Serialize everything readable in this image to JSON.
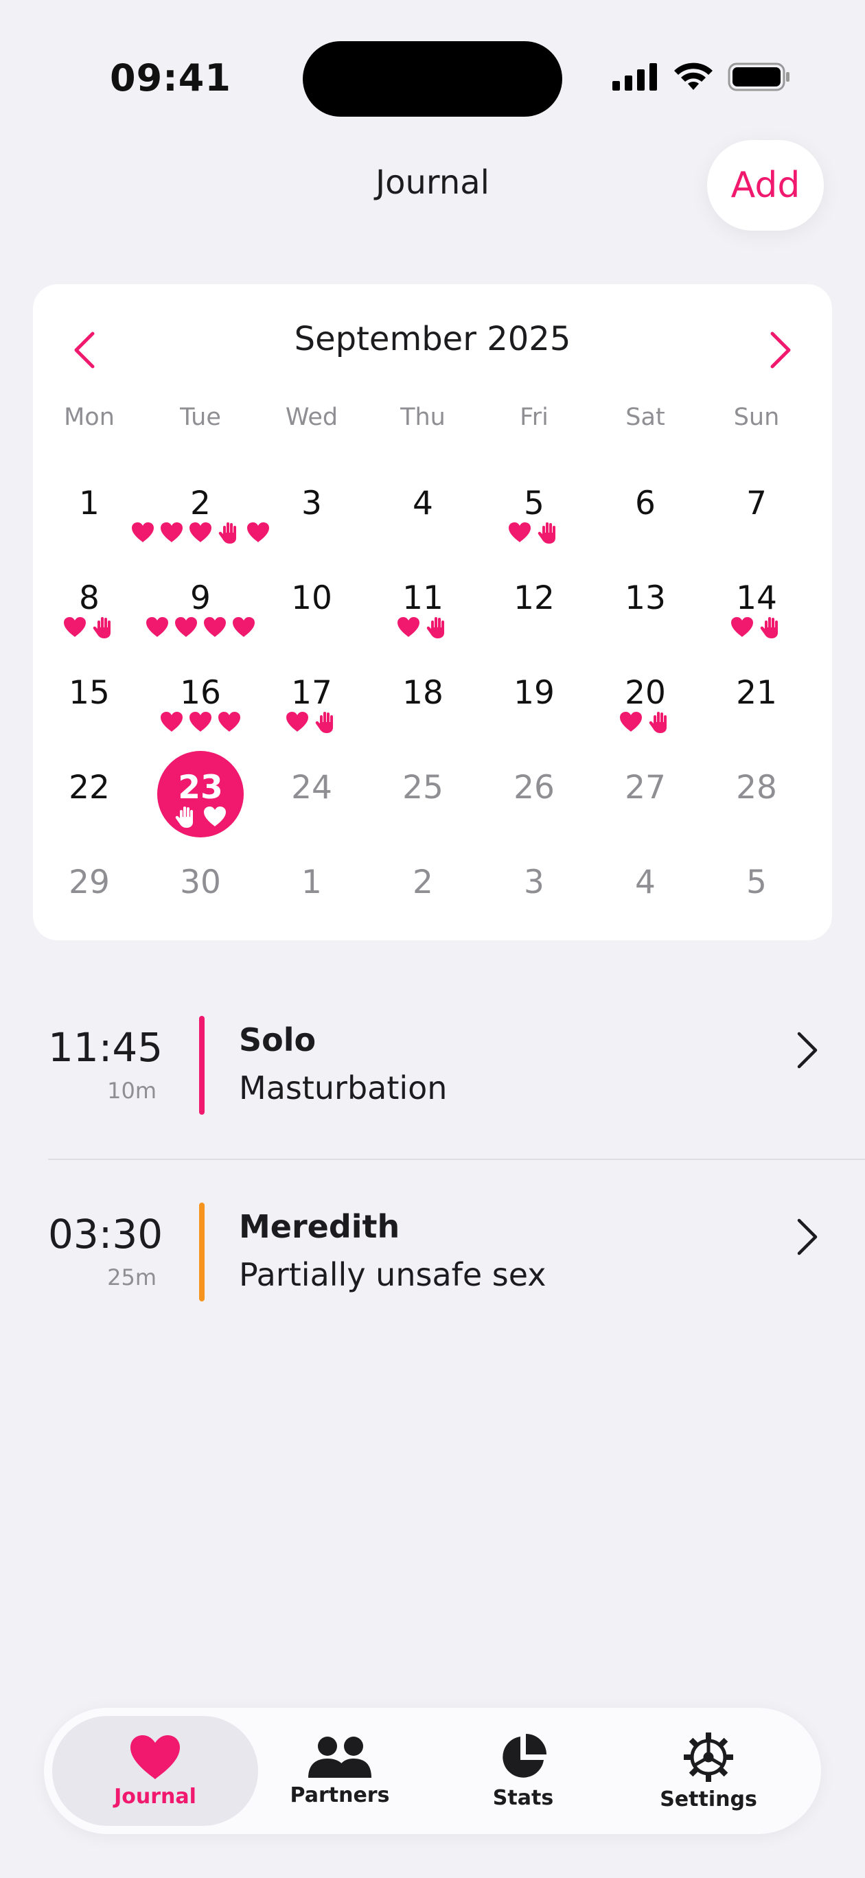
{
  "status_bar": {
    "time": "09:41"
  },
  "header": {
    "title": "Journal",
    "add_label": "Add"
  },
  "calendar": {
    "month_title": "September 2025",
    "weekdays": [
      "Mon",
      "Tue",
      "Wed",
      "Thu",
      "Fri",
      "Sat",
      "Sun"
    ],
    "accent_color": "#f0196e",
    "weeks": [
      [
        {
          "n": "1",
          "icons": []
        },
        {
          "n": "2",
          "icons": [
            "heart",
            "heart",
            "heart",
            "hand",
            "heart"
          ]
        },
        {
          "n": "3",
          "icons": []
        },
        {
          "n": "4",
          "icons": []
        },
        {
          "n": "5",
          "icons": [
            "heart",
            "hand"
          ]
        },
        {
          "n": "6",
          "icons": []
        },
        {
          "n": "7",
          "icons": []
        }
      ],
      [
        {
          "n": "8",
          "icons": [
            "heart",
            "hand"
          ]
        },
        {
          "n": "9",
          "icons": [
            "heart",
            "heart",
            "heart",
            "heart"
          ]
        },
        {
          "n": "10",
          "icons": []
        },
        {
          "n": "11",
          "icons": [
            "heart",
            "hand"
          ]
        },
        {
          "n": "12",
          "icons": []
        },
        {
          "n": "13",
          "icons": []
        },
        {
          "n": "14",
          "icons": [
            "heart",
            "hand"
          ]
        }
      ],
      [
        {
          "n": "15",
          "icons": []
        },
        {
          "n": "16",
          "icons": [
            "heart",
            "heart",
            "heart"
          ]
        },
        {
          "n": "17",
          "icons": [
            "heart",
            "hand"
          ]
        },
        {
          "n": "18",
          "icons": []
        },
        {
          "n": "19",
          "icons": []
        },
        {
          "n": "20",
          "icons": [
            "heart",
            "hand"
          ]
        },
        {
          "n": "21",
          "icons": []
        }
      ],
      [
        {
          "n": "22",
          "icons": []
        },
        {
          "n": "23",
          "icons": [
            "hand",
            "heart"
          ],
          "selected": true
        },
        {
          "n": "24",
          "icons": [],
          "faded": true
        },
        {
          "n": "25",
          "icons": [],
          "faded": true
        },
        {
          "n": "26",
          "icons": [],
          "faded": true
        },
        {
          "n": "27",
          "icons": [],
          "faded": true
        },
        {
          "n": "28",
          "icons": [],
          "faded": true
        }
      ],
      [
        {
          "n": "29",
          "icons": [],
          "faded": true
        },
        {
          "n": "30",
          "icons": [],
          "faded": true
        },
        {
          "n": "1",
          "icons": [],
          "faded": true
        },
        {
          "n": "2",
          "icons": [],
          "faded": true
        },
        {
          "n": "3",
          "icons": [],
          "faded": true
        },
        {
          "n": "4",
          "icons": [],
          "faded": true
        },
        {
          "n": "5",
          "icons": [],
          "faded": true
        }
      ]
    ]
  },
  "entries": [
    {
      "time": "11:45",
      "duration": "10m",
      "name": "Solo",
      "description": "Masturbation",
      "color": "#f0196e"
    },
    {
      "time": "03:30",
      "duration": "25m",
      "name": "Meredith",
      "description": "Partially unsafe sex",
      "color": "#f7941d"
    }
  ],
  "tabbar": {
    "tabs": [
      {
        "label": "Journal",
        "icon": "heart-icon",
        "active": true
      },
      {
        "label": "Partners",
        "icon": "people-icon"
      },
      {
        "label": "Stats",
        "icon": "pie-chart-icon"
      },
      {
        "label": "Settings",
        "icon": "gear-icon"
      }
    ]
  }
}
